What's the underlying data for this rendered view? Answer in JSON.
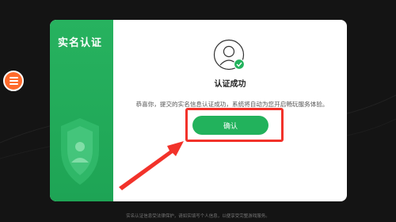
{
  "dialog": {
    "side_title": "实名认证",
    "status_title": "认证成功",
    "message": "恭喜你，提交的实名信息认证成功，系统将自动为您开启畅玩服务体验。",
    "confirm_label": "确认"
  },
  "footer_text": "实名认证信息受法律保护，请如实填写个人信息，以便享受完整游戏服务。",
  "icons": [
    "menu-icon",
    "avatar-icon",
    "check-icon",
    "shield-icon",
    "arrow-annotation"
  ],
  "colors": {
    "background": "#141414",
    "panel_green": "#27b25f",
    "button_green": "#22b25c",
    "annotation_red": "#f2322a",
    "side_button": "#ff6b2c"
  }
}
